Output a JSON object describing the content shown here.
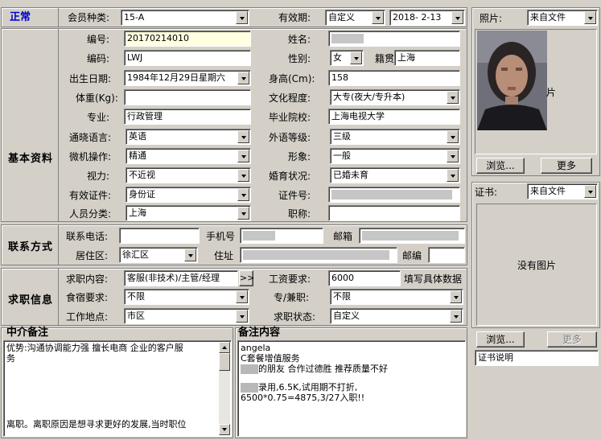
{
  "status": {
    "label": "正常",
    "color": "#0000cc"
  },
  "member_type": {
    "label": "会员种类:",
    "value": "15-A"
  },
  "validity": {
    "label": "有效期:",
    "mode": "自定义",
    "date": "2018- 2-13"
  },
  "photo": {
    "label": "照片:",
    "source": "来自文件",
    "partial_text": "片",
    "browse": "浏览...",
    "more": "更多"
  },
  "cert": {
    "label": "证书:",
    "source": "来自文件",
    "no_image": "没有图片",
    "browse": "浏览...",
    "more": "更多",
    "desc": "证书说明"
  },
  "sections": {
    "basic": "基本资料",
    "contact": "联系方式",
    "job": "求职信息"
  },
  "basic": {
    "number_label": "编号:",
    "number": "20170214010",
    "name_label": "姓名:",
    "code_label": "编码:",
    "code": "LWJ",
    "gender_label": "性别:",
    "gender": "女",
    "native_label": "籍贯",
    "native": "上海",
    "birth_label": "出生日期:",
    "birth": "1984年12月29日星期六",
    "height_label": "身高(Cm):",
    "height": "158",
    "weight_label": "体重(Kg):",
    "weight": "",
    "edu_label": "文化程度:",
    "edu": "大专(夜大/专升本)",
    "major_label": "专业:",
    "major": "行政管理",
    "school_label": "毕业院校:",
    "school": "上海电视大学",
    "lang_label": "通晓语言:",
    "lang": "英语",
    "foreign_label": "外语等级:",
    "foreign": "三级",
    "pc_label": "微机操作:",
    "pc": "精通",
    "image_label": "形象:",
    "image": "一般",
    "vision_label": "视力:",
    "vision": "不近视",
    "marital_label": "婚育状况:",
    "marital": "已婚未育",
    "id_label": "有效证件:",
    "id": "身份证",
    "idno_label": "证件号:",
    "category_label": "人员分类:",
    "category": "上海",
    "title_label": "职称:",
    "title": ""
  },
  "contact": {
    "phone_label": "联系电话:",
    "mobile_label": "手机号",
    "email_label": "邮箱",
    "district_label": "居住区:",
    "district": "徐汇区",
    "address_label": "住址",
    "zip_label": "邮编"
  },
  "job": {
    "content_label": "求职内容:",
    "content": "客服(非技术)/主管/经理",
    "more_btn": ">>",
    "salary_label": "工资要求:",
    "salary": "6000",
    "salary_hint": "填写具体数据",
    "board_label": "食宿要求:",
    "board": "不限",
    "fulltime_label": "专/兼职:",
    "fulltime": "不限",
    "place_label": "工作地点:",
    "place": "市区",
    "state_label": "求职状态:",
    "state": "自定义"
  },
  "agency_note": {
    "label": "中介备注",
    "line1": "优势:沟通协调能力强 擅长电商 企业的客户服",
    "line2": "务",
    "line3": "离职。离职原因是想寻求更好的发展,当时职位"
  },
  "remark": {
    "label": "备注内容",
    "line1": "angela",
    "line2": "C套餐增值服务",
    "line3": "的朋友 合作过德胜 推荐质量不好",
    "line4": "录用,6.5K,试用期不打折,",
    "line5": "6500*0.75=4875,3/27入职!!"
  }
}
